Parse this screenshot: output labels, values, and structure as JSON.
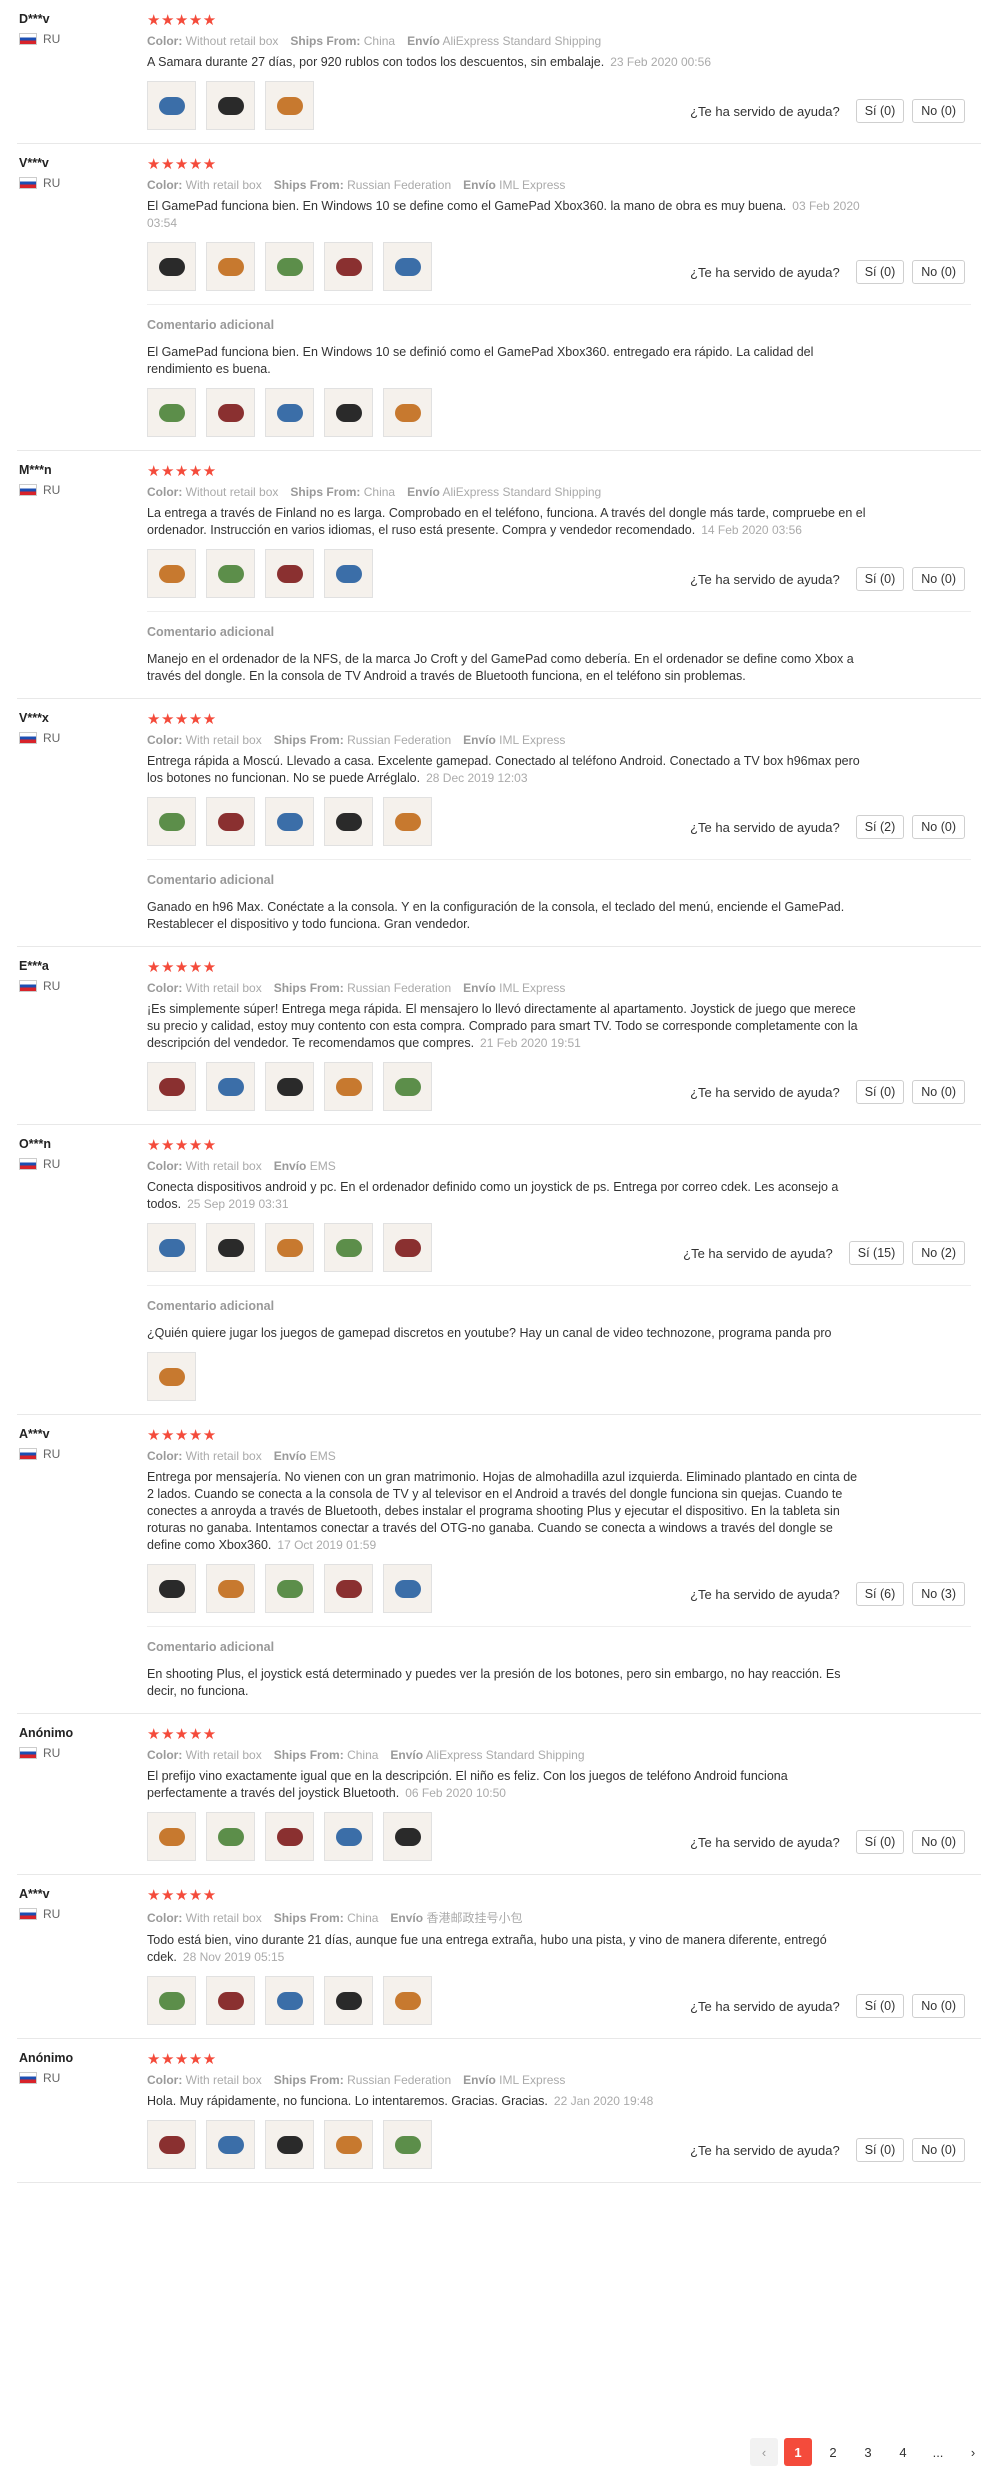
{
  "labels": {
    "color": "Color:",
    "ships": "Ships From:",
    "envio": "Envío",
    "helpful": "¿Te ha servido de ayuda?",
    "additional": "Comentario adicional",
    "stars": "★★★★★"
  },
  "reviews": [
    {
      "user": "D***v",
      "country": "RU",
      "color": "Without retail box",
      "ships": "China",
      "shipping": "AliExpress Standard Shipping",
      "text": "A Samara durante 27 días, por 920 rublos con todos los descuentos, sin embalaje.",
      "date": "23 Feb 2020 00:56",
      "yes": "Sí (0)",
      "no": "No (0)",
      "photos": 3
    },
    {
      "user": "V***v",
      "country": "RU",
      "color": "With retail box",
      "ships": "Russian Federation",
      "shipping": "IML Express",
      "text": "El GamePad funciona bien. En Windows 10 se define como el GamePad Xbox360. la mano de obra es muy buena.",
      "date": "03 Feb 2020 03:54",
      "yes": "Sí (0)",
      "no": "No (0)",
      "photos": 5,
      "additional": {
        "text": "El GamePad funciona bien. En Windows 10 se definió como el GamePad Xbox360. entregado era rápido. La calidad del rendimiento es buena.",
        "photos": 5
      }
    },
    {
      "user": "M***n",
      "country": "RU",
      "color": "Without retail box",
      "ships": "China",
      "shipping": "AliExpress Standard Shipping",
      "text": "La entrega a través de Finland no es larga. Comprobado en el teléfono, funciona. A través del dongle más tarde, compruebe en el ordenador. Instrucción en varios idiomas, el ruso está presente. Compra y vendedor recomendado.",
      "date": "14 Feb 2020 03:56",
      "yes": "Sí (0)",
      "no": "No (0)",
      "photos": 4,
      "additional": {
        "text": "Manejo en el ordenador de la NFS, de la marca Jo Croft y del GamePad como debería. En el ordenador se define como Xbox a través del dongle. En la consola de TV Android a través de Bluetooth funciona, en el teléfono sin problemas.",
        "photos": 0
      }
    },
    {
      "user": "V***x",
      "country": "RU",
      "color": "With retail box",
      "ships": "Russian Federation",
      "shipping": "IML Express",
      "text": "Entrega rápida a Moscú. Llevado a casa. Excelente gamepad. Conectado al teléfono Android. Conectado a TV box h96max pero los botones no funcionan. No se puede Arréglalo.",
      "date": "28 Dec 2019 12:03",
      "yes": "Sí (2)",
      "no": "No (0)",
      "photos": 5,
      "additional": {
        "text": "Ganado en h96 Max. Conéctate a la consola. Y en la configuración de la consola, el teclado del menú, enciende el GamePad. Restablecer el dispositivo y todo funciona. Gran vendedor.",
        "photos": 0
      }
    },
    {
      "user": "E***a",
      "country": "RU",
      "color": "With retail box",
      "ships": "Russian Federation",
      "shipping": "IML Express",
      "text": "¡Es simplemente súper! Entrega mega rápida. El mensajero lo llevó directamente al apartamento. Joystick de juego que merece su precio y calidad, estoy muy contento con esta compra. Comprado para smart TV. Todo se corresponde completamente con la descripción del vendedor. Te recomendamos que compres.",
      "date": "21 Feb 2020 19:51",
      "yes": "Sí (0)",
      "no": "No (0)",
      "photos": 5
    },
    {
      "user": "O***n",
      "country": "RU",
      "color": "With retail box",
      "ships": "",
      "shipping": "EMS",
      "text": "Conecta dispositivos android y pc. En el ordenador definido como un joystick de ps. Entrega por correo cdek. Les aconsejo a todos.",
      "date": "25 Sep 2019 03:31",
      "yes": "Sí (15)",
      "no": "No (2)",
      "photos": 5,
      "additional": {
        "text": "¿Quién quiere jugar los juegos de gamepad discretos en youtube? Hay un canal de video technozone, programa panda pro",
        "photos": 1
      }
    },
    {
      "user": "A***v",
      "country": "RU",
      "color": "With retail box",
      "ships": "",
      "shipping": "EMS",
      "text": "Entrega por mensajería. No vienen con un gran matrimonio. Hojas de almohadilla azul izquierda. Eliminado plantado en cinta de 2 lados. Cuando se conecta a la consola de TV y al televisor en el Android a través del dongle funciona sin quejas. Cuando te conectes a anroyda a través de Bluetooth, debes instalar el programa shooting Plus y ejecutar el dispositivo. En la tableta sin roturas no ganaba. Intentamos conectar a través del OTG-no ganaba. Cuando se conecta a windows a través del dongle se define como Xbox360.",
      "date": "17 Oct 2019 01:59",
      "yes": "Sí (6)",
      "no": "No (3)",
      "photos": 5,
      "additional": {
        "text": "En shooting Plus, el joystick está determinado y puedes ver la presión de los botones, pero sin embargo, no hay reacción. Es decir, no funciona.",
        "photos": 0
      }
    },
    {
      "user": "Anónimo",
      "country": "RU",
      "color": "With retail box",
      "ships": "China",
      "shipping": "AliExpress Standard Shipping",
      "text": "El prefijo vino exactamente igual que en la descripción. El niño es feliz. Con los juegos de teléfono Android funciona perfectamente a través del joystick Bluetooth.",
      "date": "06 Feb 2020 10:50",
      "yes": "Sí (0)",
      "no": "No (0)",
      "photos": 5
    },
    {
      "user": "A***v",
      "country": "RU",
      "color": "With retail box",
      "ships": "China",
      "shipping": "香港邮政挂号小包",
      "text": "Todo está bien, vino durante 21 días, aunque fue una entrega extraña, hubo una pista, y vino de manera diferente, entregó cdek.",
      "date": "28 Nov 2019 05:15",
      "yes": "Sí (0)",
      "no": "No (0)",
      "photos": 5
    },
    {
      "user": "Anónimo",
      "country": "RU",
      "color": "With retail box",
      "ships": "Russian Federation",
      "shipping": "IML Express",
      "text": "Hola. Muy rápidamente, no funciona. Lo intentaremos. Gracias. Gracias.",
      "date": "22 Jan 2020 19:48",
      "yes": "Sí (0)",
      "no": "No (0)",
      "photos": 5
    }
  ],
  "pagination": {
    "prev": "‹",
    "pages": [
      "1",
      "2",
      "3",
      "4"
    ],
    "ellipsis": "...",
    "next": "›",
    "current": "1"
  }
}
